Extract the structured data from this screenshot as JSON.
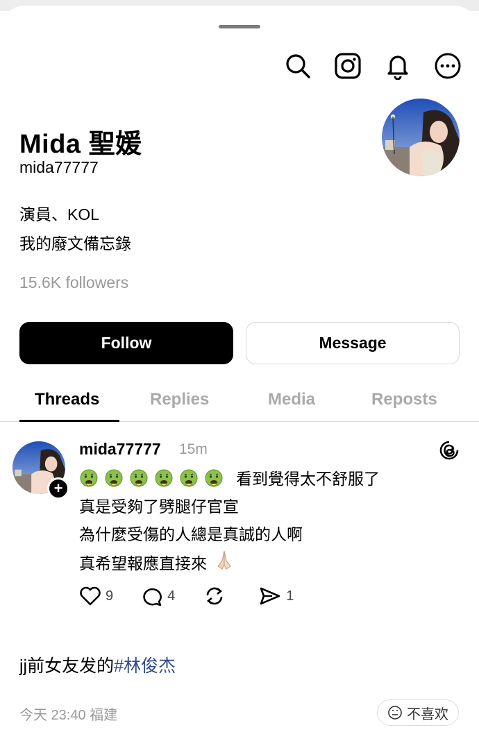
{
  "header": {
    "icons": [
      "search-icon",
      "instagram-icon",
      "bell-icon",
      "more-icon"
    ]
  },
  "profile": {
    "name": "Mida 聖媛",
    "handle": "mida77777",
    "bio_line1": "演員、KOL",
    "bio_line2": "我的廢文備忘錄",
    "followers": "15.6K followers"
  },
  "buttons": {
    "follow": "Follow",
    "message": "Message"
  },
  "tabs": [
    {
      "label": "Threads",
      "active": true
    },
    {
      "label": "Replies",
      "active": false
    },
    {
      "label": "Media",
      "active": false
    },
    {
      "label": "Reposts",
      "active": false
    }
  ],
  "post": {
    "user": "mida77777",
    "time": "15m",
    "emoji_count": 6,
    "emoji_name": "nauseated-face-emoji",
    "line1": "看到覺得太不舒服了",
    "line2": "真是受夠了劈腿仔官宣",
    "line3": "為什麼受傷的人總是真誠的人啊",
    "line4": "真希望報應直接來",
    "line4_emoji": "folded-hands-emoji",
    "likes": "9",
    "comments": "4",
    "reposts": "",
    "shares": "1"
  },
  "caption": {
    "text": "jj前女友发的",
    "tag": "#林俊杰"
  },
  "meta": {
    "timestamp": "今天 23:40 福建",
    "dislike": "不喜欢"
  },
  "colors": {
    "accent_tag": "#2f4a8a",
    "muted_text": "#999999",
    "button_dark": "#000000"
  }
}
